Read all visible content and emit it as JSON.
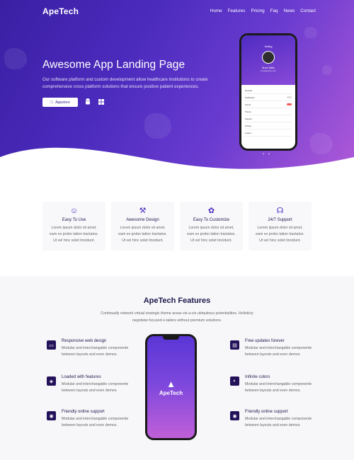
{
  "brand": "ApeTech",
  "nav": [
    "Home",
    "Features",
    "Pricing",
    "Faq",
    "News",
    "Contact"
  ],
  "hero": {
    "title": "Awesome App Landing Page",
    "subtitle": "Our software platform and custom development allow healthcare institutions to create comprehensive cross platform solutions that ensure positive patient experiences.",
    "appstore_label": "Appstore",
    "appstore_icon": "apple-icon",
    "android_icon": "android-icon",
    "windows_icon": "windows-icon",
    "phone": {
      "title": "Setting",
      "user_name": "Bruce Watts",
      "user_email": "bruce@yahoo.com",
      "rows": [
        {
          "label": "General",
          "toggle": null
        },
        {
          "label": "Notification",
          "toggle": "off"
        },
        {
          "label": "Sound",
          "toggle": "on"
        },
        {
          "label": "Theme",
          "toggle": null
        },
        {
          "label": "Support",
          "toggle": null
        },
        {
          "label": "Privacy",
          "toggle": null
        },
        {
          "label": "Logout",
          "toggle": null
        }
      ]
    },
    "carousel_prev": "‹",
    "carousel_next": "›"
  },
  "cards": [
    {
      "title": "Easy To Use",
      "text": "Lorem ipsum dolor sit amet, eam ex probo tation tractatos. Ut vel hinc solet tincidunt.",
      "icon": "smile-icon"
    },
    {
      "title": "Awesome Design",
      "text": "Lorem ipsum dolor sit amet, eam ex probo tation tractatos. Ut vel hinc solet tincidunt.",
      "icon": "magic-wand-icon"
    },
    {
      "title": "Easy To Customize",
      "text": "Lorem ipsum dolor sit amet, eam ex probo tation tractatos. Ut vel hinc solet tincidunt.",
      "icon": "palette-icon"
    },
    {
      "title": "24/7 Support",
      "text": "Lorem ipsum dolor sit amet, eam ex probo tation tractatos. Ut vel hinc solet tincidunt.",
      "icon": "headset-icon"
    }
  ],
  "features": {
    "title": "ApeTech Features",
    "description": "Continually network virtual strategic theme areas vis-a-vis ubiquitous potentialities. Holisticly negotiate focused e-tailers without premium solutions.",
    "phone_brand": "ApeTech",
    "left": [
      {
        "title": "Responsive web design",
        "text": "Modular and interchangable componente between layouts and even demos.",
        "icon": "responsive-icon"
      },
      {
        "title": "Loaded with features",
        "text": "Modular and interchangable componente between layouts and even demos.",
        "icon": "layers-icon"
      },
      {
        "title": "Friendly online support",
        "text": "Modular and interchangable componente between layouts and even demos.",
        "icon": "support-icon"
      }
    ],
    "right": [
      {
        "title": "Free updates forever",
        "text": "Modular and interchangable componente between layouts and even demos.",
        "icon": "update-icon"
      },
      {
        "title": "Infinite colors",
        "text": "Modular and interchangable componente between layouts and even demos.",
        "icon": "colors-icon"
      },
      {
        "title": "Friendly online support",
        "text": "Modular and interchangable componente between layouts and even demos.",
        "icon": "support-icon"
      }
    ]
  },
  "colors": {
    "primary": "#4b2bbd",
    "accent": "#b05ad8",
    "dark": "#1e1a4d"
  }
}
